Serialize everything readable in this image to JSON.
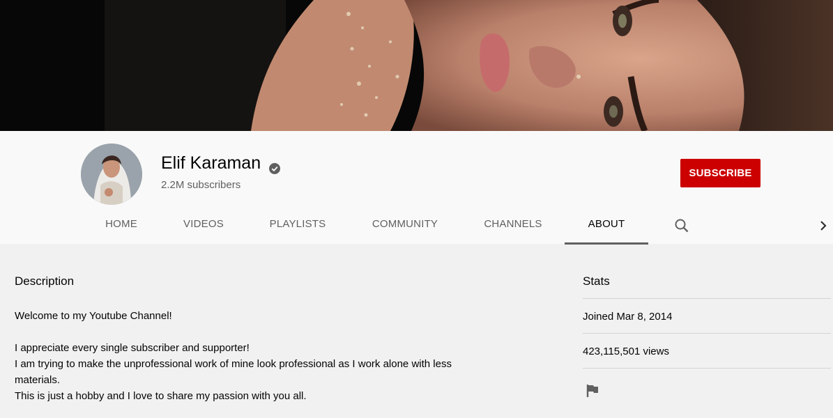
{
  "channel": {
    "name": "Elif Karaman",
    "subscribers": "2.2M subscribers",
    "verified": true
  },
  "subscribe_button": {
    "label": "SUBSCRIBE",
    "color": "#cc0000"
  },
  "tabs": [
    {
      "label": "HOME",
      "active": false
    },
    {
      "label": "VIDEOS",
      "active": false
    },
    {
      "label": "PLAYLISTS",
      "active": false
    },
    {
      "label": "COMMUNITY",
      "active": false
    },
    {
      "label": "CHANNELS",
      "active": false
    },
    {
      "label": "ABOUT",
      "active": true
    }
  ],
  "tab_icons": {
    "search": "search-icon",
    "next": "chevron-right-icon"
  },
  "about": {
    "description_title": "Description",
    "description_lines": [
      "Welcome to my Youtube Channel!",
      "",
      "I appreciate every single subscriber and supporter!",
      "I am trying to make the unprofessional work of mine look professional as I work alone with less materials.",
      "This is just a hobby and I love to share my passion with you all."
    ],
    "stats_title": "Stats",
    "joined": "Joined Mar 8, 2014",
    "views": "423,115,501 views",
    "report_icon": "flag-icon"
  }
}
